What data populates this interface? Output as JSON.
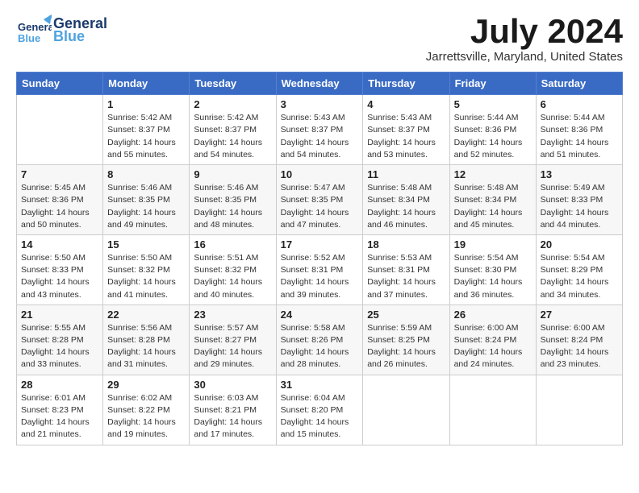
{
  "header": {
    "logo_general": "General",
    "logo_blue": "Blue",
    "month_title": "July 2024",
    "location": "Jarrettsville, Maryland, United States"
  },
  "days_of_week": [
    "Sunday",
    "Monday",
    "Tuesday",
    "Wednesday",
    "Thursday",
    "Friday",
    "Saturday"
  ],
  "weeks": [
    [
      {
        "day": "",
        "info": ""
      },
      {
        "day": "1",
        "info": "Sunrise: 5:42 AM\nSunset: 8:37 PM\nDaylight: 14 hours\nand 55 minutes."
      },
      {
        "day": "2",
        "info": "Sunrise: 5:42 AM\nSunset: 8:37 PM\nDaylight: 14 hours\nand 54 minutes."
      },
      {
        "day": "3",
        "info": "Sunrise: 5:43 AM\nSunset: 8:37 PM\nDaylight: 14 hours\nand 54 minutes."
      },
      {
        "day": "4",
        "info": "Sunrise: 5:43 AM\nSunset: 8:37 PM\nDaylight: 14 hours\nand 53 minutes."
      },
      {
        "day": "5",
        "info": "Sunrise: 5:44 AM\nSunset: 8:36 PM\nDaylight: 14 hours\nand 52 minutes."
      },
      {
        "day": "6",
        "info": "Sunrise: 5:44 AM\nSunset: 8:36 PM\nDaylight: 14 hours\nand 51 minutes."
      }
    ],
    [
      {
        "day": "7",
        "info": "Sunrise: 5:45 AM\nSunset: 8:36 PM\nDaylight: 14 hours\nand 50 minutes."
      },
      {
        "day": "8",
        "info": "Sunrise: 5:46 AM\nSunset: 8:35 PM\nDaylight: 14 hours\nand 49 minutes."
      },
      {
        "day": "9",
        "info": "Sunrise: 5:46 AM\nSunset: 8:35 PM\nDaylight: 14 hours\nand 48 minutes."
      },
      {
        "day": "10",
        "info": "Sunrise: 5:47 AM\nSunset: 8:35 PM\nDaylight: 14 hours\nand 47 minutes."
      },
      {
        "day": "11",
        "info": "Sunrise: 5:48 AM\nSunset: 8:34 PM\nDaylight: 14 hours\nand 46 minutes."
      },
      {
        "day": "12",
        "info": "Sunrise: 5:48 AM\nSunset: 8:34 PM\nDaylight: 14 hours\nand 45 minutes."
      },
      {
        "day": "13",
        "info": "Sunrise: 5:49 AM\nSunset: 8:33 PM\nDaylight: 14 hours\nand 44 minutes."
      }
    ],
    [
      {
        "day": "14",
        "info": "Sunrise: 5:50 AM\nSunset: 8:33 PM\nDaylight: 14 hours\nand 43 minutes."
      },
      {
        "day": "15",
        "info": "Sunrise: 5:50 AM\nSunset: 8:32 PM\nDaylight: 14 hours\nand 41 minutes."
      },
      {
        "day": "16",
        "info": "Sunrise: 5:51 AM\nSunset: 8:32 PM\nDaylight: 14 hours\nand 40 minutes."
      },
      {
        "day": "17",
        "info": "Sunrise: 5:52 AM\nSunset: 8:31 PM\nDaylight: 14 hours\nand 39 minutes."
      },
      {
        "day": "18",
        "info": "Sunrise: 5:53 AM\nSunset: 8:31 PM\nDaylight: 14 hours\nand 37 minutes."
      },
      {
        "day": "19",
        "info": "Sunrise: 5:54 AM\nSunset: 8:30 PM\nDaylight: 14 hours\nand 36 minutes."
      },
      {
        "day": "20",
        "info": "Sunrise: 5:54 AM\nSunset: 8:29 PM\nDaylight: 14 hours\nand 34 minutes."
      }
    ],
    [
      {
        "day": "21",
        "info": "Sunrise: 5:55 AM\nSunset: 8:28 PM\nDaylight: 14 hours\nand 33 minutes."
      },
      {
        "day": "22",
        "info": "Sunrise: 5:56 AM\nSunset: 8:28 PM\nDaylight: 14 hours\nand 31 minutes."
      },
      {
        "day": "23",
        "info": "Sunrise: 5:57 AM\nSunset: 8:27 PM\nDaylight: 14 hours\nand 29 minutes."
      },
      {
        "day": "24",
        "info": "Sunrise: 5:58 AM\nSunset: 8:26 PM\nDaylight: 14 hours\nand 28 minutes."
      },
      {
        "day": "25",
        "info": "Sunrise: 5:59 AM\nSunset: 8:25 PM\nDaylight: 14 hours\nand 26 minutes."
      },
      {
        "day": "26",
        "info": "Sunrise: 6:00 AM\nSunset: 8:24 PM\nDaylight: 14 hours\nand 24 minutes."
      },
      {
        "day": "27",
        "info": "Sunrise: 6:00 AM\nSunset: 8:24 PM\nDaylight: 14 hours\nand 23 minutes."
      }
    ],
    [
      {
        "day": "28",
        "info": "Sunrise: 6:01 AM\nSunset: 8:23 PM\nDaylight: 14 hours\nand 21 minutes."
      },
      {
        "day": "29",
        "info": "Sunrise: 6:02 AM\nSunset: 8:22 PM\nDaylight: 14 hours\nand 19 minutes."
      },
      {
        "day": "30",
        "info": "Sunrise: 6:03 AM\nSunset: 8:21 PM\nDaylight: 14 hours\nand 17 minutes."
      },
      {
        "day": "31",
        "info": "Sunrise: 6:04 AM\nSunset: 8:20 PM\nDaylight: 14 hours\nand 15 minutes."
      },
      {
        "day": "",
        "info": ""
      },
      {
        "day": "",
        "info": ""
      },
      {
        "day": "",
        "info": ""
      }
    ]
  ]
}
